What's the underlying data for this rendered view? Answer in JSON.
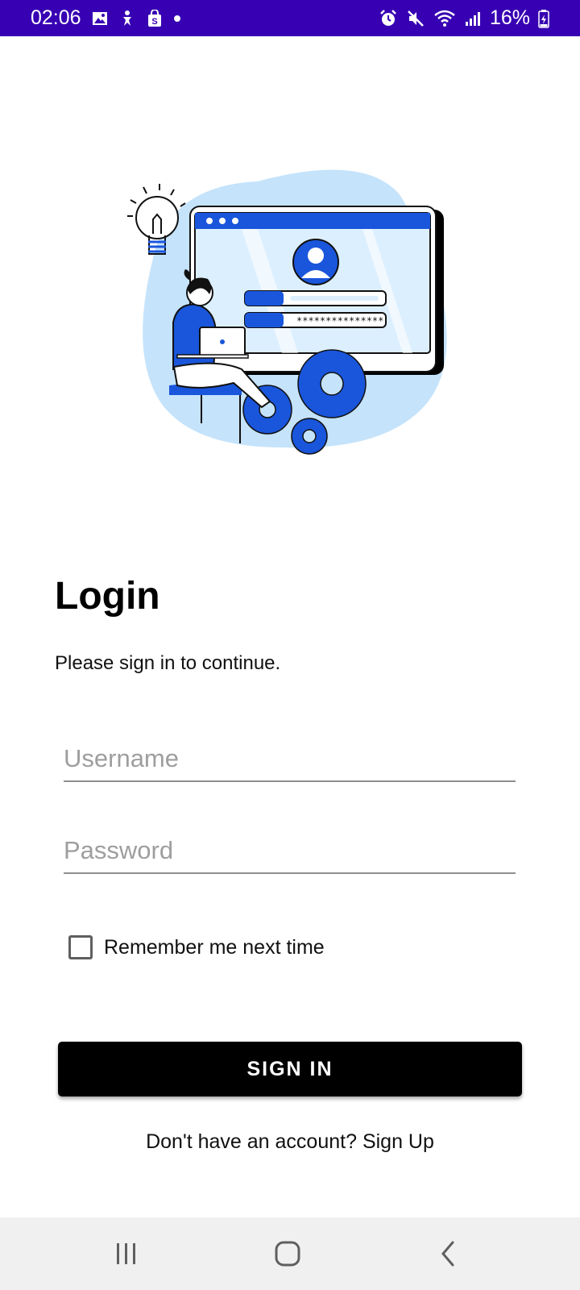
{
  "status_bar": {
    "time": "02:06",
    "battery": "16%",
    "left_icons": [
      "gallery-icon",
      "accessibility-icon",
      "shopping-bag-icon",
      "dot-icon"
    ],
    "right_icons": [
      "alarm-icon",
      "mute-icon",
      "wifi-icon",
      "signal-icon",
      "battery-icon"
    ],
    "background_color": "#3700b3"
  },
  "illustration": {
    "name": "login-illustration",
    "accent_color": "#1a56db",
    "light_color": "#c5e3fb"
  },
  "login": {
    "title": "Login",
    "subtitle": "Please sign in to continue.",
    "username_placeholder": "Username",
    "username_value": "",
    "password_placeholder": "Password",
    "password_value": "",
    "remember_label": "Remember me next time",
    "remember_checked": false,
    "sign_in_label": "SIGN IN",
    "sign_up_text": "Don't have an account? Sign Up"
  },
  "nav_bar": {
    "buttons": [
      "recents-icon",
      "home-icon",
      "back-icon"
    ]
  }
}
